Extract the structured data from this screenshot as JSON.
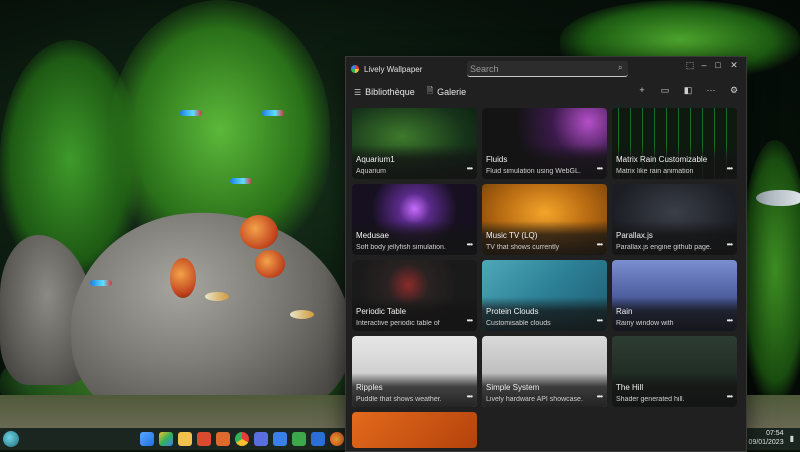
{
  "app": {
    "title": "Lively Wallpaper",
    "search_placeholder": "Search",
    "window_controls": {
      "minimize": "–",
      "maximize": "□",
      "close": "✕",
      "extra": "⬚"
    }
  },
  "nav": {
    "tabs": [
      {
        "label": "Bibliothèque",
        "icon": "library-icon"
      },
      {
        "label": "Galerie",
        "icon": "gallery-icon"
      }
    ],
    "actions": [
      {
        "icon": "add-icon",
        "glyph": "+"
      },
      {
        "icon": "monitor-icon",
        "glyph": "▭"
      },
      {
        "icon": "customize-icon",
        "glyph": "◧"
      },
      {
        "icon": "more-icon",
        "glyph": "···"
      },
      {
        "icon": "settings-icon",
        "glyph": "⚙"
      }
    ]
  },
  "wallpapers": [
    {
      "title": "Aquarium1",
      "desc": "Aquarium",
      "theme": "aquarium"
    },
    {
      "title": "Fluids",
      "desc": "Fluid simulation using WebGL.",
      "theme": "fluids"
    },
    {
      "title": "Matrix Rain Customizable",
      "desc": "Matrix like rain animation",
      "theme": "matrix"
    },
    {
      "title": "Medusae",
      "desc": "Soft body jellyfish simulation.",
      "theme": "medusae"
    },
    {
      "title": "Music TV (LQ)",
      "desc": "TV that shows currently",
      "theme": "tv"
    },
    {
      "title": "Parallax.js",
      "desc": "Parallax.js engine github page.",
      "theme": "parallax"
    },
    {
      "title": "Periodic Table",
      "desc": "Interactive periodic table of",
      "theme": "periodic"
    },
    {
      "title": "Protein Clouds",
      "desc": "Customisable clouds",
      "theme": "clouds"
    },
    {
      "title": "Rain",
      "desc": "Rainy window with",
      "theme": "rain"
    },
    {
      "title": "Ripples",
      "desc": "Puddle that shows weather.",
      "theme": "ripples"
    },
    {
      "title": "Simple System",
      "desc": "Lively hardware API showcase.",
      "theme": "system"
    },
    {
      "title": "The Hill",
      "desc": "Shader generated hill.",
      "theme": "hill"
    },
    {
      "title": "",
      "desc": "",
      "theme": "orange"
    }
  ],
  "card_more": "•••",
  "taskbar": {
    "time": "07:54",
    "date": "09/01/2023",
    "tray_icon": "notification-icon"
  }
}
